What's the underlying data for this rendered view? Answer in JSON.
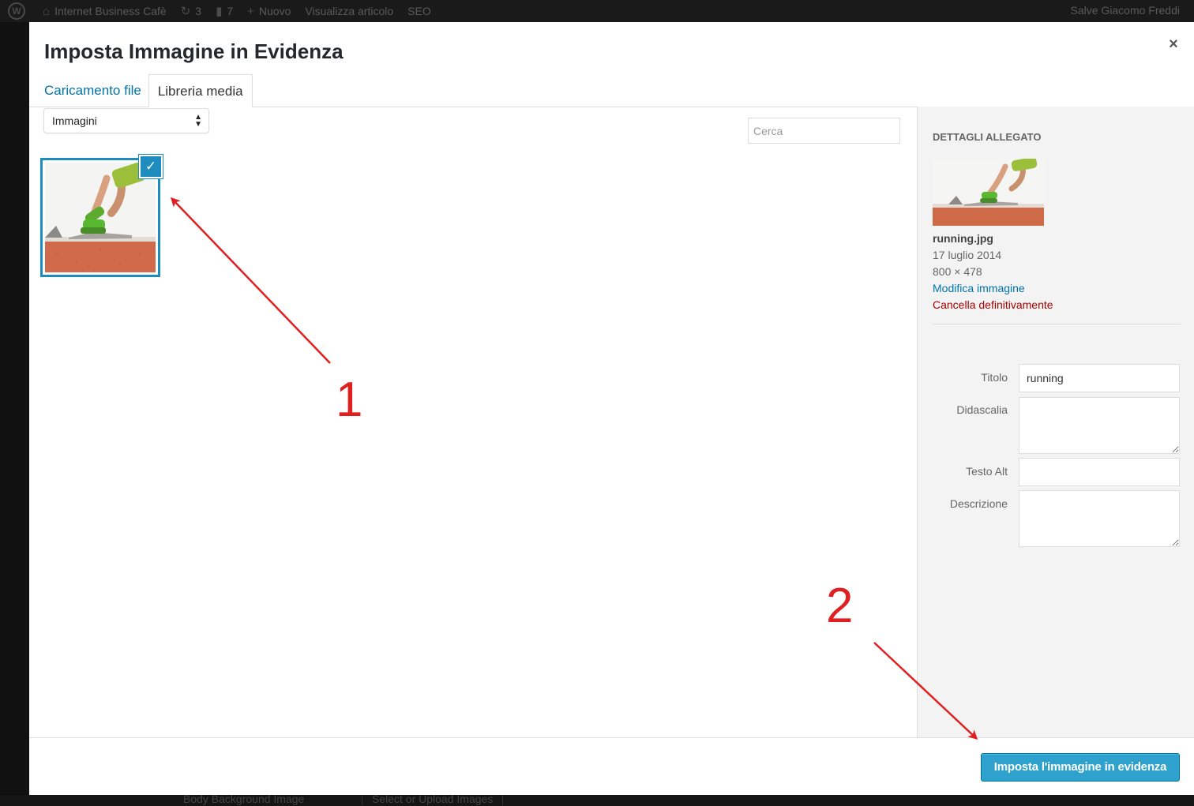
{
  "admin_bar": {
    "wp_logo": "W",
    "site_name": "Internet Business Cafè",
    "updates_count": "3",
    "comments_count": "7",
    "new_label": "Nuovo",
    "view_post_label": "Visualizza articolo",
    "seo_label": "SEO",
    "greeting": "Salve Giacomo Freddi"
  },
  "modal": {
    "title": "Imposta Immagine in Evidenza",
    "close_glyph": "×",
    "tabs": [
      {
        "label": "Caricamento file"
      },
      {
        "label": "Libreria media"
      }
    ],
    "active_tab": "Libreria media",
    "filter_select": {
      "value": "Immagini"
    },
    "search": {
      "placeholder": "Cerca"
    }
  },
  "attachments": [
    {
      "name": "running.jpg",
      "selected": true
    }
  ],
  "sidebar": {
    "heading": "DETTAGLI ALLEGATO",
    "filename": "running.jpg",
    "date": "17 luglio 2014",
    "dimensions": "800 × 478",
    "edit_link": "Modifica immagine",
    "delete_link": "Cancella definitivamente",
    "fields": {
      "title_label": "Titolo",
      "title_value": "running",
      "caption_label": "Didascalia",
      "caption_value": "",
      "alt_label": "Testo Alt",
      "alt_value": "",
      "description_label": "Descrizione",
      "description_value": ""
    }
  },
  "footer": {
    "primary_button": "Imposta l'immagine in evidenza"
  },
  "background_page": {
    "label": "Body Background Image",
    "button": "Select or Upload Images"
  },
  "annotations": [
    {
      "number": "1"
    },
    {
      "number": "2"
    }
  ],
  "colors": {
    "accent": "#2ea2cc",
    "selection": "#1e8cbe",
    "link": "#0073aa",
    "delete": "#aa0000",
    "annotation": "#e02020"
  }
}
